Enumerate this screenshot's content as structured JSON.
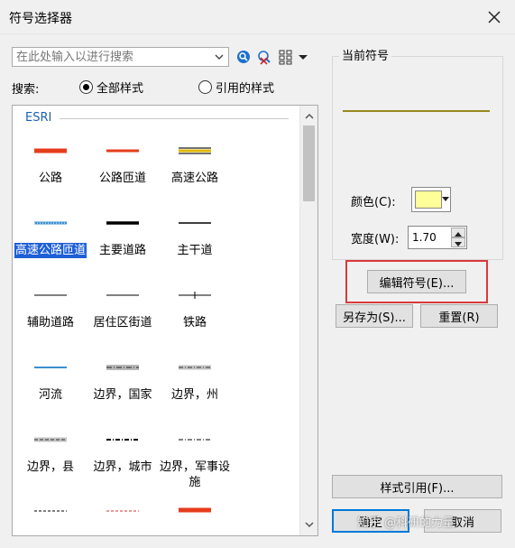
{
  "window": {
    "title": "符号选择器",
    "close_icon": "close-icon"
  },
  "search": {
    "placeholder": "在此处输入以进行搜索",
    "label": "搜索:",
    "options": [
      "全部样式",
      "引用的样式"
    ],
    "selected": 0
  },
  "gallery": {
    "group": "ESRI",
    "items": [
      {
        "label": "公路",
        "stroke": "#e53c1c"
      },
      {
        "label": "公路匝道",
        "stroke": "#e53c1c"
      },
      {
        "label": "高速公路",
        "stroke": "#8a6d00"
      },
      {
        "label": "高速公路匝道",
        "stroke": "#3b8fd1",
        "selected": true
      },
      {
        "label": "主要道路",
        "stroke": "#000000"
      },
      {
        "label": "主干道",
        "stroke": "#000000"
      },
      {
        "label": "辅助道路",
        "stroke": "#000000"
      },
      {
        "label": "居住区街道",
        "stroke": "#000000"
      },
      {
        "label": "铁路",
        "stroke": "#000000"
      },
      {
        "label": "河流",
        "stroke": "#3b8fd1"
      },
      {
        "label": "边界，国家",
        "stroke": "#8c8c8c"
      },
      {
        "label": "边界，州",
        "stroke": "#8c8c8c"
      },
      {
        "label": "边界，县",
        "stroke": "#8c8c8c"
      },
      {
        "label": "边界，城市",
        "stroke": "#000000"
      },
      {
        "label": "边界，军事设施",
        "stroke": "#000000"
      }
    ]
  },
  "current_symbol": {
    "legend": "当前符号",
    "color_label": "颜色(C):",
    "color": "#ffff99",
    "width_label": "宽度(W):",
    "width_value": "1.70",
    "edit_button": "编辑符号(E)..."
  },
  "buttons": {
    "save_as": "另存为(S)...",
    "reset": "重置(R)",
    "style_ref": "样式引用(F)...",
    "ok": "确定",
    "cancel": "取消"
  },
  "watermark": "知乎 @科研的力量",
  "colors": {
    "accent": "#1e5fd6",
    "highlight": "#d83a3a"
  }
}
